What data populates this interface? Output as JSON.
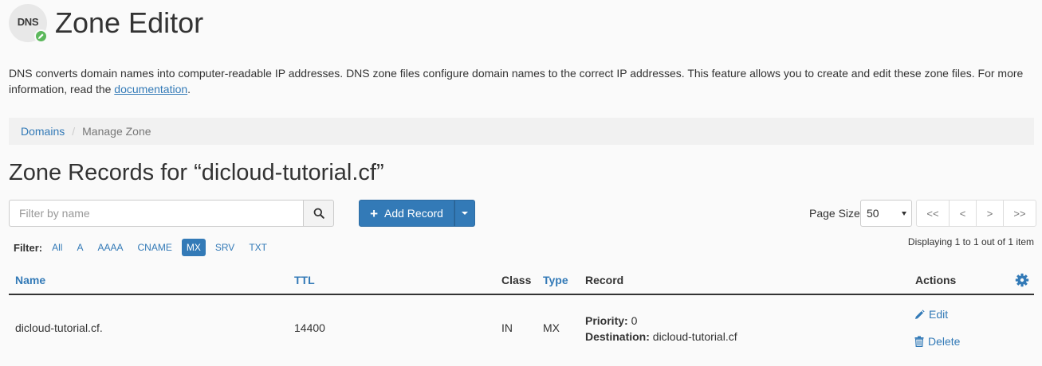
{
  "app": {
    "logo_text": "DNS",
    "title": "Zone Editor"
  },
  "description": {
    "text": "DNS converts domain names into computer-readable IP addresses. DNS zone files configure domain names to the correct IP addresses. This feature allows you to create and edit these zone files. For more information, read the ",
    "link_text": "documentation",
    "suffix": "."
  },
  "breadcrumb": {
    "parent": "Domains",
    "separator": "/",
    "current": "Manage Zone"
  },
  "zone": {
    "heading": "Zone Records for “dicloud-tutorial.cf”"
  },
  "search": {
    "placeholder": "Filter by name",
    "value": ""
  },
  "toolbar": {
    "add_record_label": "Add Record",
    "page_size_label": "Page Size",
    "page_size_value": "50",
    "pager": [
      "<<",
      "<",
      ">",
      ">>"
    ],
    "displaying": "Displaying 1 to 1 out of 1 item"
  },
  "filter": {
    "label": "Filter:",
    "options": [
      "All",
      "A",
      "AAAA",
      "CNAME",
      "MX",
      "SRV",
      "TXT"
    ],
    "active": "MX"
  },
  "table": {
    "columns": {
      "name": "Name",
      "ttl": "TTL",
      "class": "Class",
      "type": "Type",
      "record": "Record",
      "actions": "Actions"
    },
    "rows": [
      {
        "name": "dicloud-tutorial.cf.",
        "ttl": "14400",
        "class": "IN",
        "type": "MX",
        "priority_label": "Priority:",
        "priority_value": "0",
        "destination_label": "Destination:",
        "destination_value": "dicloud-tutorial.cf",
        "edit_label": "Edit",
        "delete_label": "Delete"
      }
    ]
  },
  "colors": {
    "accent": "#337ab7",
    "success": "#5cb85c",
    "background": "#fafafa"
  }
}
